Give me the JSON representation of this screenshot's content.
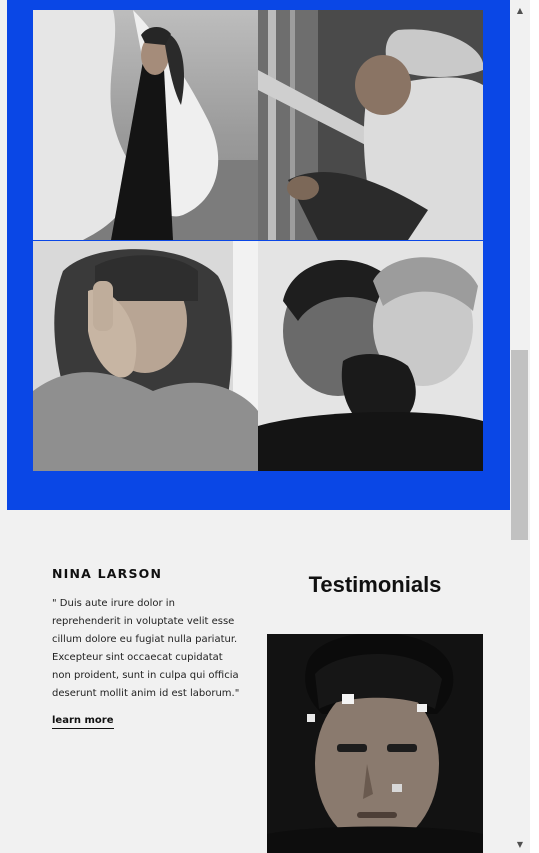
{
  "gallery": {
    "accent_color": "#0a47e6",
    "images": [
      {
        "name": "woman-with-white-fabric-photo"
      },
      {
        "name": "man-in-beanie-on-balcony-photo"
      },
      {
        "name": "woman-with-hand-gesture-photo"
      },
      {
        "name": "double-exposure-bearded-man-photo"
      }
    ]
  },
  "testimonial": {
    "author": "NINA LARSON",
    "quote": "\" Duis aute irure dolor in reprehenderit in voluptate velit esse cillum dolore eu fugiat nulla pariatur. Excepteur sint occaecat cupidatat non proident, sunt in culpa qui officia deserunt mollit anim id est laborum.\"",
    "link_label": "learn more",
    "section_title": "Testimonials",
    "portrait": "man-portrait-with-light-spots-photo"
  },
  "scrollbar": {
    "up_icon": "▲",
    "down_icon": "▼"
  }
}
